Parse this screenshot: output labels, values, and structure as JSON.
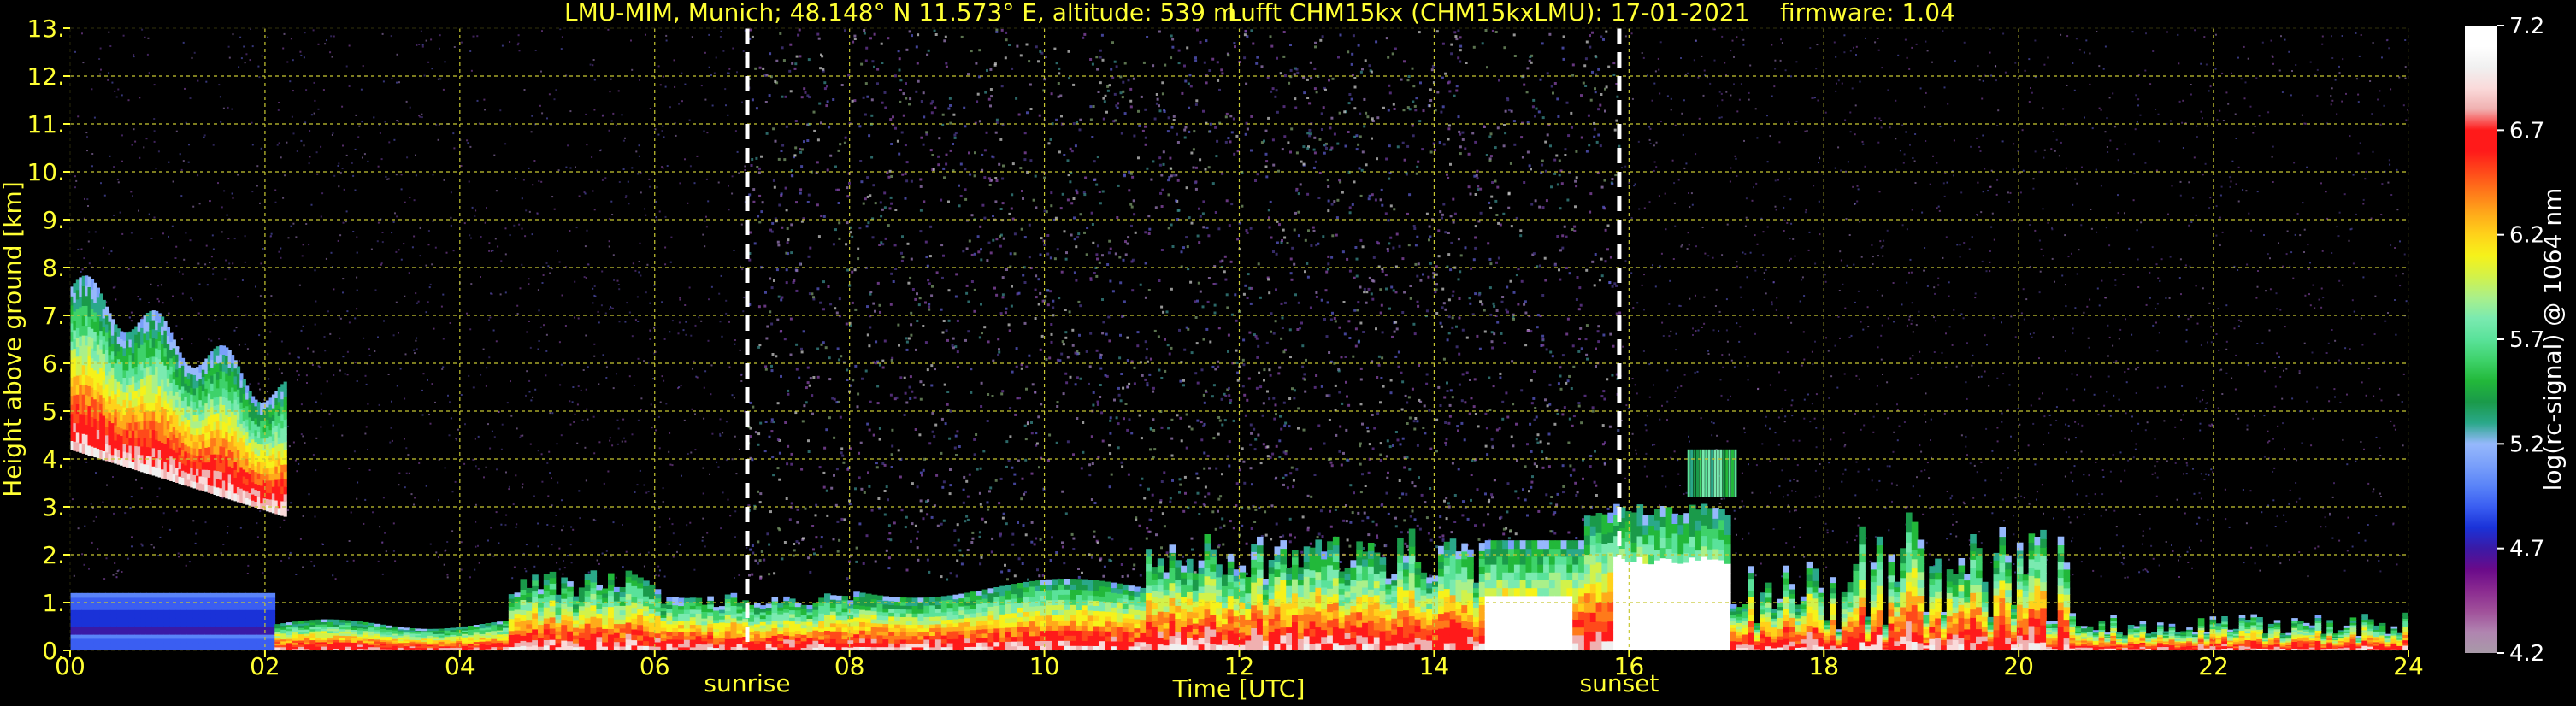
{
  "title_left": "LMU-MIM, Munich; 48.148° N 11.573° E, altitude: 539 m",
  "title_right": "Lufft CHM15kx (CHM15kxLMU): 17-01-2021    firmware: 1.04",
  "colors": {
    "axis_text": "#ffff33",
    "grid": "#c8c832",
    "background": "#000000",
    "event_line": "#ffffff"
  },
  "chart_data": {
    "type": "heatmap",
    "xlabel": "Time [UTC]",
    "ylabel": "Height above ground [km]",
    "colorbar_label": "log(rc-signal) @ 1064 nm",
    "xlim": [
      0,
      24
    ],
    "ylim": [
      0,
      13
    ],
    "x_ticks": [
      0,
      2,
      4,
      6,
      8,
      10,
      12,
      14,
      16,
      18,
      20,
      22,
      24
    ],
    "x_tick_labels": [
      "00",
      "02",
      "04",
      "06",
      "08",
      "10",
      "12",
      "14",
      "16",
      "18",
      "20",
      "22",
      "24"
    ],
    "y_ticks": [
      0,
      1,
      2,
      3,
      4,
      5,
      6,
      7,
      8,
      9,
      10,
      11,
      12,
      13
    ],
    "y_tick_labels": [
      "0.",
      "1.",
      "2.",
      "3.",
      "4.",
      "5.",
      "6.",
      "7.",
      "8.",
      "9.",
      "10.",
      "11.",
      "12.",
      "13."
    ],
    "grid": true,
    "clim": [
      4.2,
      7.2
    ],
    "colorbar_ticks": [
      4.2,
      4.7,
      5.2,
      5.7,
      6.2,
      6.7,
      7.2
    ],
    "colorbar_tick_labels": [
      "4.2",
      "4.7",
      "5.2",
      "5.7",
      "6.2",
      "6.7",
      "7.2"
    ],
    "colormap": [
      "#a89aa8",
      "#b084b0",
      "#a0509a",
      "#8a2a90",
      "#6a0a8a",
      "#3a1aa6",
      "#1a32d8",
      "#3a5ef2",
      "#5a84f8",
      "#7aa0fa",
      "#96b8fc",
      "#2aa88a",
      "#1a9a4a",
      "#22b83a",
      "#3ed26a",
      "#5ae29a",
      "#7aeab0",
      "#aaf08a",
      "#d2f24a",
      "#f6f21a",
      "#ffd21a",
      "#ffaa1a",
      "#ff7a1a",
      "#ff4a1a",
      "#ff1a1a",
      "#ff1a1a",
      "#f0b0b0",
      "#fadada",
      "#f0f0f0",
      "#ffffff",
      "#ffffff"
    ],
    "events": [
      {
        "name": "sunrise",
        "x": 6.95
      },
      {
        "name": "sunset",
        "x": 15.9
      }
    ]
  }
}
